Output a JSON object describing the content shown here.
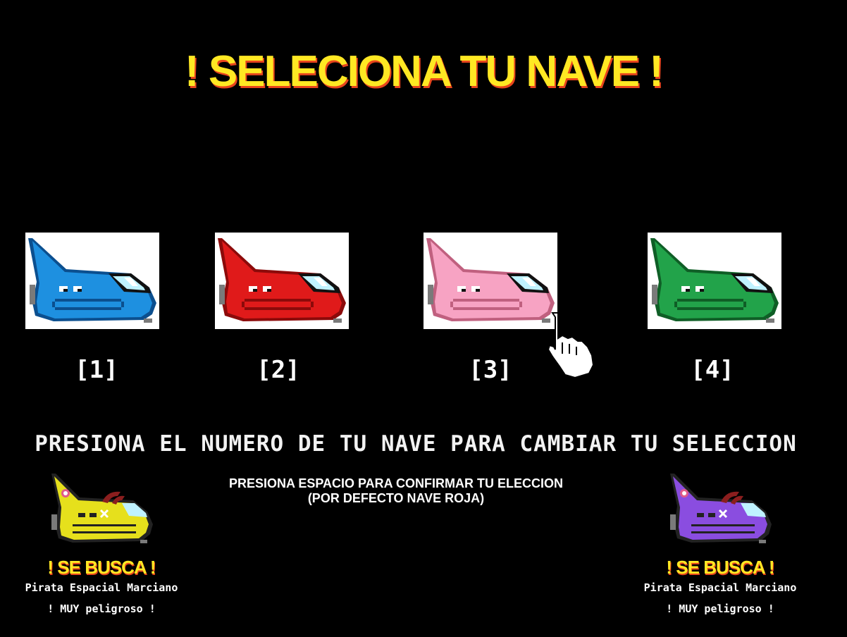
{
  "title": "! SELECIONA TU NAVE !",
  "ships": [
    {
      "label": "[1]",
      "color": "#1e90e0",
      "dark": "#0b4f8f",
      "icon": "blue-ship"
    },
    {
      "label": "[2]",
      "color": "#e01a1a",
      "dark": "#8c0a0a",
      "icon": "red-ship"
    },
    {
      "label": "[3]",
      "color": "#f7a3c3",
      "dark": "#c0607f",
      "icon": "pink-ship"
    },
    {
      "label": "[4]",
      "color": "#22a34a",
      "dark": "#0f5e26",
      "icon": "green-ship"
    }
  ],
  "instruction": "PRESIONA EL NUMERO DE TU NAVE PARA CAMBIAR TU SELECCION",
  "confirm_line1": "PRESIONA ESPACIO PARA CONFIRMAR TU ELECCION",
  "confirm_line2": "(POR DEFECTO NAVE ROJA)",
  "wanted_left": {
    "title": "! SE BUSCA !",
    "subtitle": "Pirata Espacial Marciano",
    "note": "! MUY peligroso !",
    "color": "#e6e01c"
  },
  "wanted_right": {
    "title": "! SE BUSCA !",
    "subtitle": "Pirata Espacial Marciano",
    "note": "! MUY peligroso !",
    "color": "#8a4de0"
  },
  "accent": "#ffe823",
  "cursor_icon": "hand-pointer-icon"
}
